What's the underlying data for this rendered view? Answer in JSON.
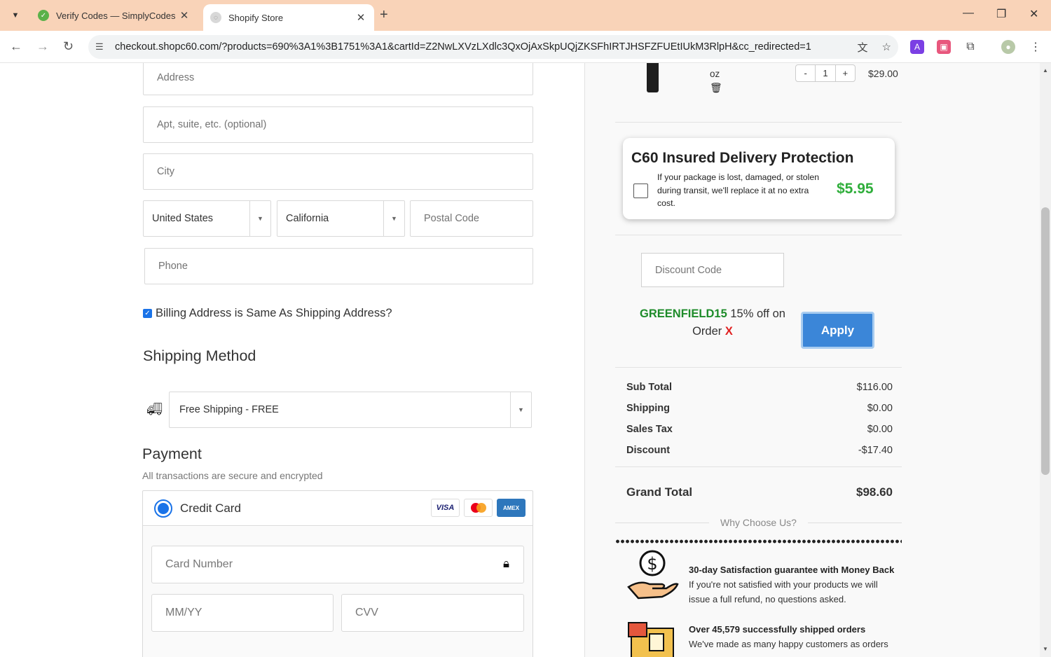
{
  "browser": {
    "tabs": [
      {
        "title": "Verify Codes — SimplyCodes",
        "active": false
      },
      {
        "title": "Shopify Store",
        "active": true
      }
    ],
    "url": "checkout.shopc60.com/?products=690%3A1%3B1751%3A1&cartId=Z2NwLXVzLXdlc3QxOjAxSkpUQjZKSFhIRTJHSFZFUEtIUkM3RlpH&cc_redirected=1"
  },
  "form": {
    "address_placeholder": "Address",
    "apt_placeholder": "Apt, suite, etc. (optional)",
    "city_placeholder": "City",
    "country_value": "United States",
    "state_value": "California",
    "postal_placeholder": "Postal Code",
    "phone_placeholder": "Phone",
    "billing_same_label": "Billing Address is Same As Shipping Address?",
    "billing_same_checked": true
  },
  "shipping": {
    "heading": "Shipping Method",
    "selected": "Free Shipping - FREE"
  },
  "payment": {
    "heading": "Payment",
    "subtitle": "All transactions are secure and encrypted",
    "method_label": "Credit Card",
    "card_brands": [
      "VISA",
      "MC",
      "AMEX"
    ],
    "card_number_placeholder": "Card Number",
    "expiry_placeholder": "MM/YY",
    "cvv_placeholder": "CVV"
  },
  "cart": {
    "item_unit": "oz",
    "quantity": "1",
    "minus": "-",
    "plus": "+",
    "price": "$29.00"
  },
  "protection": {
    "title": "C60 Insured Delivery Protection",
    "description": "If your package is lost, damaged, or stolen during transit, we'll replace it at no extra cost.",
    "price": "$5.95"
  },
  "discount": {
    "placeholder": "Discount Code",
    "applied_code": "GREENFIELD15",
    "applied_text": "15% off on Order",
    "remove": "X",
    "apply_label": "Apply"
  },
  "summary": {
    "subtotal_label": "Sub Total",
    "subtotal": "$116.00",
    "shipping_label": "Shipping",
    "shipping": "$0.00",
    "tax_label": "Sales Tax",
    "tax": "$0.00",
    "discount_label": "Discount",
    "discount": "-$17.40",
    "grand_label": "Grand Total",
    "grand": "$98.60"
  },
  "why": {
    "heading": "Why Choose Us?",
    "items": [
      {
        "title": "30-day Satisfaction guarantee with Money Back",
        "desc": "If you're not satisfied with your products we will issue a full refund, no questions asked."
      },
      {
        "title": "Over 45,579 successfully shipped orders",
        "desc": "We've made as many happy customers as orders"
      }
    ]
  }
}
